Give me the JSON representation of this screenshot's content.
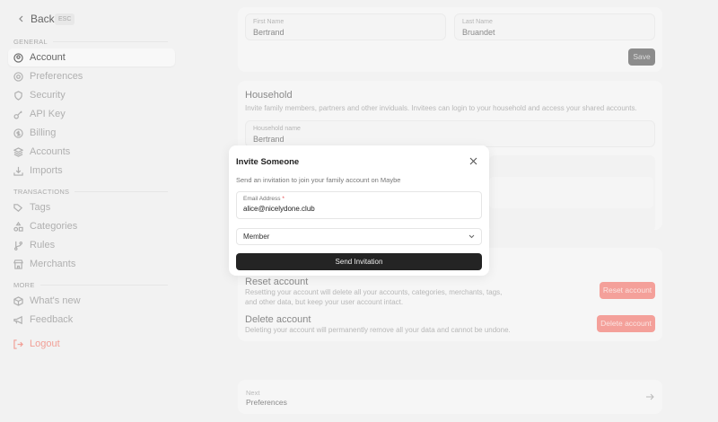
{
  "nav": {
    "back": "Back",
    "esc": "ESC"
  },
  "sidebar": {
    "sections": [
      {
        "title": "GENERAL",
        "items": [
          "Account",
          "Preferences",
          "Security",
          "API Key",
          "Billing",
          "Accounts",
          "Imports"
        ]
      },
      {
        "title": "TRANSACTIONS",
        "items": [
          "Tags",
          "Categories",
          "Rules",
          "Merchants"
        ]
      },
      {
        "title": "MORE",
        "items": [
          "What's new",
          "Feedback"
        ]
      }
    ],
    "logout": "Logout"
  },
  "profile": {
    "first_label": "First Name",
    "first_value": "Bertrand",
    "last_label": "Last Name",
    "last_value": "Bruandet",
    "save": "Save"
  },
  "household": {
    "title": "Household",
    "desc": "Invite family members, partners and other inviduals. Invitees can login to your household and access your shared accounts.",
    "name_label": "Household name",
    "name_value": "Bertrand"
  },
  "danger": {
    "reset_title": "Reset account",
    "reset_desc": "Resetting your account will delete all your accounts, categories, merchants, tags, and other data, but keep your user account intact.",
    "reset_button": "Reset account",
    "delete_title": "Delete account",
    "delete_desc": "Deleting your account will permanently remove all your data and cannot be undone.",
    "delete_button": "Delete account"
  },
  "next": {
    "label": "Next",
    "page": "Preferences"
  },
  "modal": {
    "title": "Invite Someone",
    "desc": "Send an invitation to join your family account on Maybe",
    "email_label": "Email Address",
    "required": "*",
    "email_value": "alice@nicelydone.club",
    "role": "Member",
    "send": "Send Invitation"
  }
}
